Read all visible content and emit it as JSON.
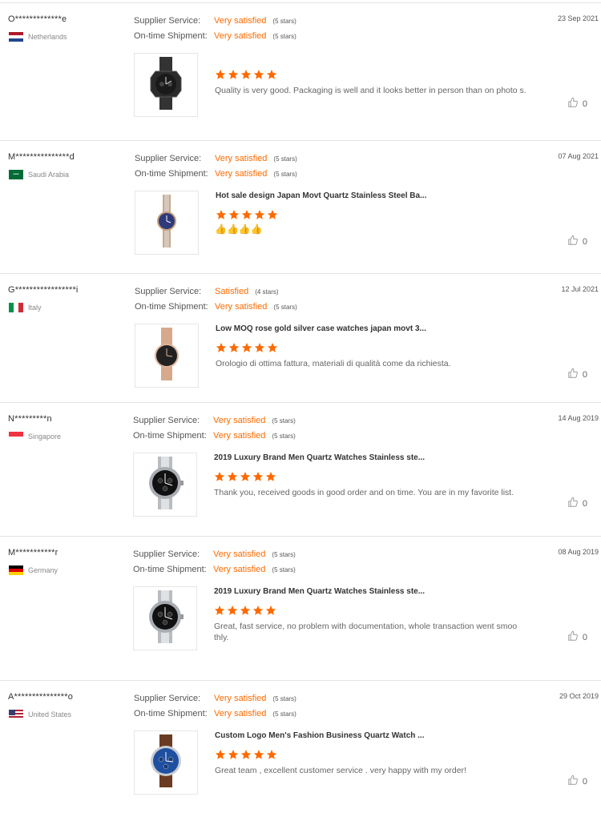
{
  "reviews": [
    {
      "buyer": "O*************e",
      "country": "Netherlands",
      "flag": "nl",
      "supplier_label": "Supplier Service:",
      "supplier_value": "Very satisfied",
      "supplier_stars": "(5 stars)",
      "shipment_label": "On-time Shipment:",
      "shipment_value": "Very satisfied",
      "shipment_stars": "(5 stars)",
      "date": "23 Sep 2021",
      "product_title": "",
      "rating": 5,
      "comment": "Quality is very good. Packaging is well and it looks better in person than on photo s.",
      "likes": "0",
      "watch": "black-octagon"
    },
    {
      "buyer": "M***************d",
      "country": "Saudi Arabia",
      "flag": "sa",
      "supplier_label": "Supplier Service:",
      "supplier_value": "Very satisfied",
      "supplier_stars": "(5 stars)",
      "shipment_label": "On-time Shipment:",
      "shipment_value": "Very satisfied",
      "shipment_stars": "(5 stars)",
      "date": "07 Aug 2021",
      "product_title": "Hot sale design Japan Movt Quartz Stainless Steel Ba...",
      "rating": 5,
      "comment": "",
      "emoji": "👍👍👍👍",
      "likes": "0",
      "watch": "ladies-blue"
    },
    {
      "buyer": "G*****************i",
      "country": "Italy",
      "flag": "it",
      "supplier_label": "Supplier Service:",
      "supplier_value": "Satisfied",
      "supplier_stars": "(4 stars)",
      "shipment_label": "On-time Shipment:",
      "shipment_value": "Very satisfied",
      "shipment_stars": "(5 stars)",
      "date": "12 Jul 2021",
      "product_title": "Low MOQ rose gold silver case watches japan movt 3...",
      "rating": 5,
      "comment": "Orologio di ottima fattura, materiali di qualità come da richiesta.",
      "likes": "0",
      "watch": "rosegold-mesh"
    },
    {
      "buyer": "N*********n",
      "country": "Singapore",
      "flag": "sg",
      "supplier_label": "Supplier Service:",
      "supplier_value": "Very satisfied",
      "supplier_stars": "(5 stars)",
      "shipment_label": "On-time Shipment:",
      "shipment_value": "Very satisfied",
      "shipment_stars": "(5 stars)",
      "date": "14 Aug 2019",
      "product_title": "2019 Luxury Brand Men Quartz Watches Stainless ste...",
      "rating": 5,
      "comment": "Thank you, received goods in good order and on time. You are in my favorite list.",
      "likes": "0",
      "watch": "steel-chrono"
    },
    {
      "buyer": "M***********r",
      "country": "Germany",
      "flag": "de",
      "supplier_label": "Supplier Service:",
      "supplier_value": "Very satisfied",
      "supplier_stars": "(5 stars)",
      "shipment_label": "On-time Shipment:",
      "shipment_value": "Very satisfied",
      "shipment_stars": "(5 stars)",
      "date": "08 Aug 2019",
      "product_title": "2019 Luxury Brand Men Quartz Watches Stainless ste...",
      "rating": 5,
      "comment": "Great, fast service, no problem with documentation, whole transaction went smoo thly.",
      "likes": "0",
      "watch": "steel-chrono"
    },
    {
      "buyer": "A***************o",
      "country": "United States",
      "flag": "us",
      "supplier_label": "Supplier Service:",
      "supplier_value": "Very satisfied",
      "supplier_stars": "(5 stars)",
      "shipment_label": "On-time Shipment:",
      "shipment_value": "Very satisfied",
      "shipment_stars": "(5 stars)",
      "date": "29 Oct 2019",
      "product_title": "Custom Logo Men's Fashion Business Quartz Watch ...",
      "rating": 5,
      "comment": "Great team , excellent customer service . very happy with my order!",
      "likes": "0",
      "watch": "leather-blue"
    }
  ],
  "colors": {
    "accent": "#ff6a00",
    "border": "#e3e3e3"
  },
  "icons": {
    "rating": "star-icon",
    "like": "thumbs-up-icon"
  }
}
